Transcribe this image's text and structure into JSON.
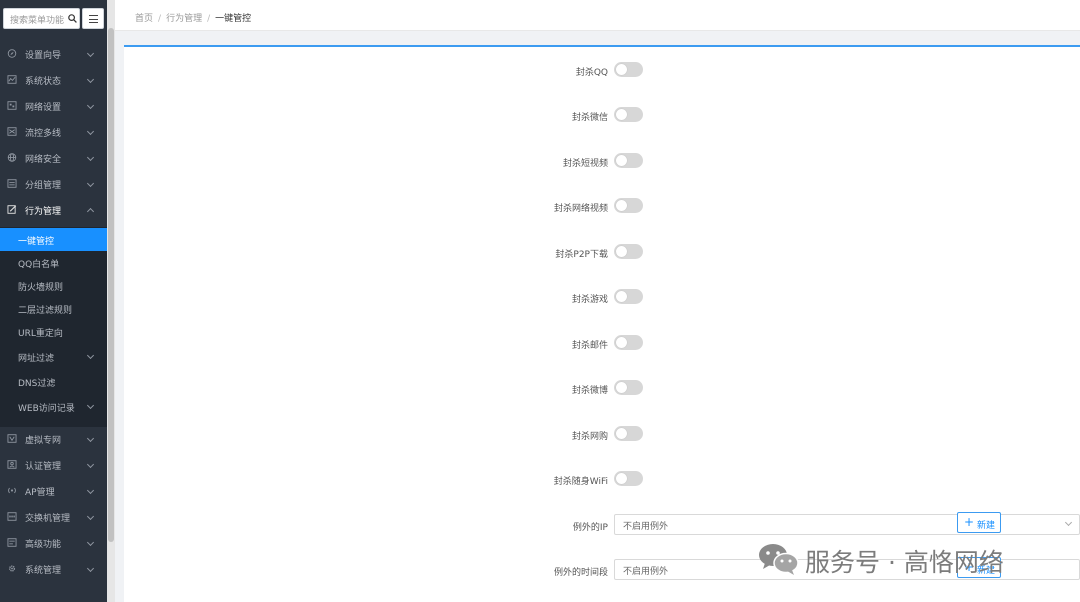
{
  "search": {
    "placeholder": "搜索菜单功能"
  },
  "nav": [
    {
      "label": "设置向导",
      "icon": "compass-icon"
    },
    {
      "label": "系统状态",
      "icon": "chart-icon"
    },
    {
      "label": "网络设置",
      "icon": "network-icon"
    },
    {
      "label": "流控多线",
      "icon": "flow-icon"
    },
    {
      "label": "网络安全",
      "icon": "globe-icon"
    },
    {
      "label": "分组管理",
      "icon": "group-icon"
    },
    {
      "label": "行为管理",
      "icon": "edit-icon"
    }
  ],
  "submenu": [
    {
      "label": "一键管控",
      "active": true
    },
    {
      "label": "QQ白名单"
    },
    {
      "label": "防火墙规则"
    },
    {
      "label": "二层过滤规则"
    },
    {
      "label": "URL重定向"
    },
    {
      "label": "网址过滤"
    },
    {
      "label": "DNS过滤"
    },
    {
      "label": "WEB访问记录"
    }
  ],
  "nav_bottom": [
    {
      "label": "虚拟专网",
      "icon": "vpn-icon"
    },
    {
      "label": "认证管理",
      "icon": "auth-icon"
    },
    {
      "label": "AP管理",
      "icon": "wifi-ap-icon"
    },
    {
      "label": "交换机管理",
      "icon": "switch-icon"
    },
    {
      "label": "高级功能",
      "icon": "advanced-icon"
    },
    {
      "label": "系统管理",
      "icon": "gear-icon"
    }
  ],
  "breadcrumb": {
    "home": "首页",
    "parent": "行为管理",
    "current": "一键管控",
    "separator": "/"
  },
  "toggles": [
    {
      "label": "封杀QQ",
      "on": false
    },
    {
      "label": "封杀微信",
      "on": false
    },
    {
      "label": "封杀短视频",
      "on": false
    },
    {
      "label": "封杀网络视频",
      "on": false
    },
    {
      "label": "封杀P2P下载",
      "on": false
    },
    {
      "label": "封杀游戏",
      "on": false
    },
    {
      "label": "封杀邮件",
      "on": false
    },
    {
      "label": "封杀微博",
      "on": false
    },
    {
      "label": "封杀网购",
      "on": false
    },
    {
      "label": "封杀随身WiFi",
      "on": false
    }
  ],
  "exception_ip": {
    "label": "例外的IP",
    "value": "不启用例外",
    "button": "新建"
  },
  "exception_time": {
    "label": "例外的时间段",
    "value": "不启用例外",
    "button": "新建"
  },
  "watermark": {
    "text": "服务号 · 高恪网络"
  },
  "colors": {
    "sidebar": "#2b333e",
    "submenu": "#1f262f",
    "accent": "#1890ff",
    "toggle_off": "#d7d7d7"
  }
}
